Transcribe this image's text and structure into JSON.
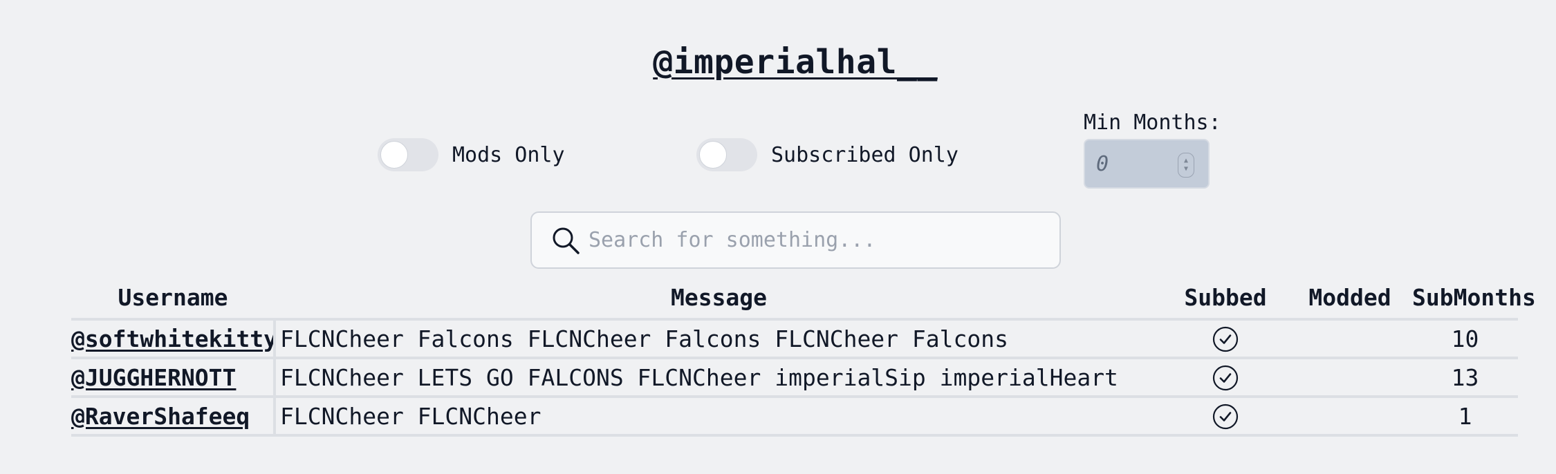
{
  "header": {
    "title": "@imperialhal__"
  },
  "filters": {
    "mods_only_label": "Mods Only",
    "subscribed_only_label": "Subscribed Only",
    "min_months_label": "Min Months:",
    "min_months_value": "0"
  },
  "search": {
    "placeholder": "Search for something...",
    "icon": "search-icon"
  },
  "table": {
    "columns": [
      "Username",
      "Message",
      "Subbed",
      "Modded",
      "SubMonths"
    ],
    "rows": [
      {
        "username": "@softwhitekitty",
        "message": "FLCNCheer Falcons FLCNCheer Falcons FLCNCheer Falcons",
        "subbed": true,
        "modded": false,
        "submonths": "10"
      },
      {
        "username": "@JUGGHERNOTT",
        "message": "FLCNCheer LETS GO FALCONS FLCNCheer  imperialSip imperialHeart",
        "subbed": true,
        "modded": false,
        "submonths": "13"
      },
      {
        "username": "@RaverShafeeq",
        "message": "FLCNCheer FLCNCheer",
        "subbed": true,
        "modded": false,
        "submonths": "1"
      }
    ]
  }
}
